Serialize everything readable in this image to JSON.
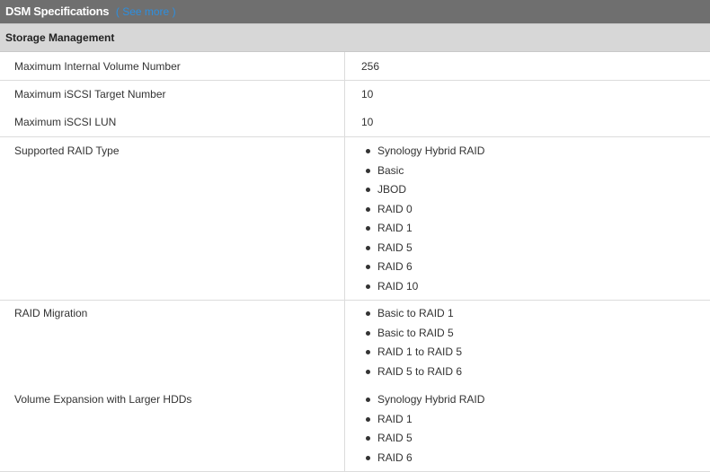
{
  "header": {
    "title": "DSM Specifications",
    "see_more": "( See more )"
  },
  "section": {
    "title": "Storage Management"
  },
  "rows": [
    {
      "label": "Maximum Internal Volume Number",
      "value": "256"
    },
    {
      "label": "Maximum iSCSI Target Number",
      "value": "10"
    },
    {
      "label": "Maximum iSCSI LUN",
      "value": "10"
    }
  ],
  "raid_type": {
    "label": "Supported RAID Type",
    "items": [
      "Synology Hybrid RAID",
      "Basic",
      "JBOD",
      "RAID 0",
      "RAID 1",
      "RAID 5",
      "RAID 6",
      "RAID 10"
    ]
  },
  "raid_migration": {
    "label": "RAID Migration",
    "items": [
      "Basic to RAID 1",
      "Basic to RAID 5",
      "RAID 1 to RAID 5",
      "RAID 5 to RAID 6"
    ]
  },
  "volume_expansion": {
    "label": "Volume Expansion with Larger HDDs",
    "items": [
      "Synology Hybrid RAID",
      "RAID 1",
      "RAID 5",
      "RAID 6"
    ]
  }
}
